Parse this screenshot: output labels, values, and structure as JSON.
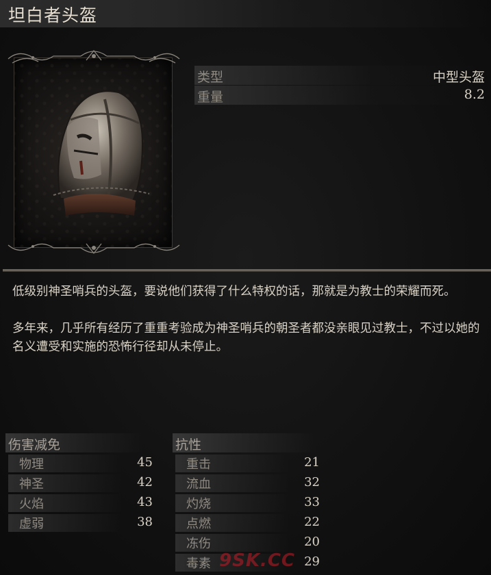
{
  "item": {
    "name": "坦白者头盔",
    "icon": "confessor-helm-icon"
  },
  "attributes": [
    {
      "label": "类型",
      "value": "中型头盔"
    },
    {
      "label": "重量",
      "value": "8.2"
    }
  ],
  "description": [
    "低级别神圣哨兵的头盔，要说他们获得了什么特权的话，那就是为教士的荣耀而死。",
    "多年来，几乎所有经历了重重考验成为神圣哨兵的朝圣者都没亲眼见过教士，不过以她的名义遭受和实施的恐怖行径却从未停止。"
  ],
  "damage_negation": {
    "title": "伤害减免",
    "stats": [
      {
        "label": "物理",
        "value": "45"
      },
      {
        "label": "神圣",
        "value": "42"
      },
      {
        "label": "火焰",
        "value": "43"
      },
      {
        "label": "虚弱",
        "value": "38"
      }
    ]
  },
  "resistance": {
    "title": "抗性",
    "stats": [
      {
        "label": "重击",
        "value": "21"
      },
      {
        "label": "流血",
        "value": "32"
      },
      {
        "label": "灼烧",
        "value": "33"
      },
      {
        "label": "点燃",
        "value": "22"
      },
      {
        "label": "冻伤",
        "value": "20"
      },
      {
        "label": "毒素",
        "value": "29"
      }
    ]
  },
  "watermark": "9SK.CC",
  "colors": {
    "background": "#121212",
    "text": "#d9d2c6",
    "label": "#8f8a82",
    "watermark": "#be1e28"
  }
}
